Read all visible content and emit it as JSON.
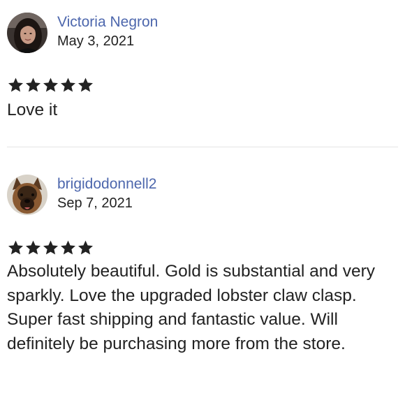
{
  "reviews": [
    {
      "author": "Victoria Negron",
      "date": "May 3, 2021",
      "rating": 5,
      "rating_max": 5,
      "text": "Love it",
      "avatar_icon": "user-photo-woman"
    },
    {
      "author": "brigidodonnell2",
      "date": "Sep 7, 2021",
      "rating": 5,
      "rating_max": 5,
      "text": "Absolutely beautiful. Gold is substantial and very sparkly. Love the upgraded lobster claw clasp.\nSuper fast shipping and fantastic value. Will definitely be purchasing more from the store.",
      "avatar_icon": "user-photo-dog"
    }
  ],
  "colors": {
    "author_link": "#4d67ad",
    "text": "#222222",
    "star": "#222222",
    "divider": "#e4e4e4"
  }
}
